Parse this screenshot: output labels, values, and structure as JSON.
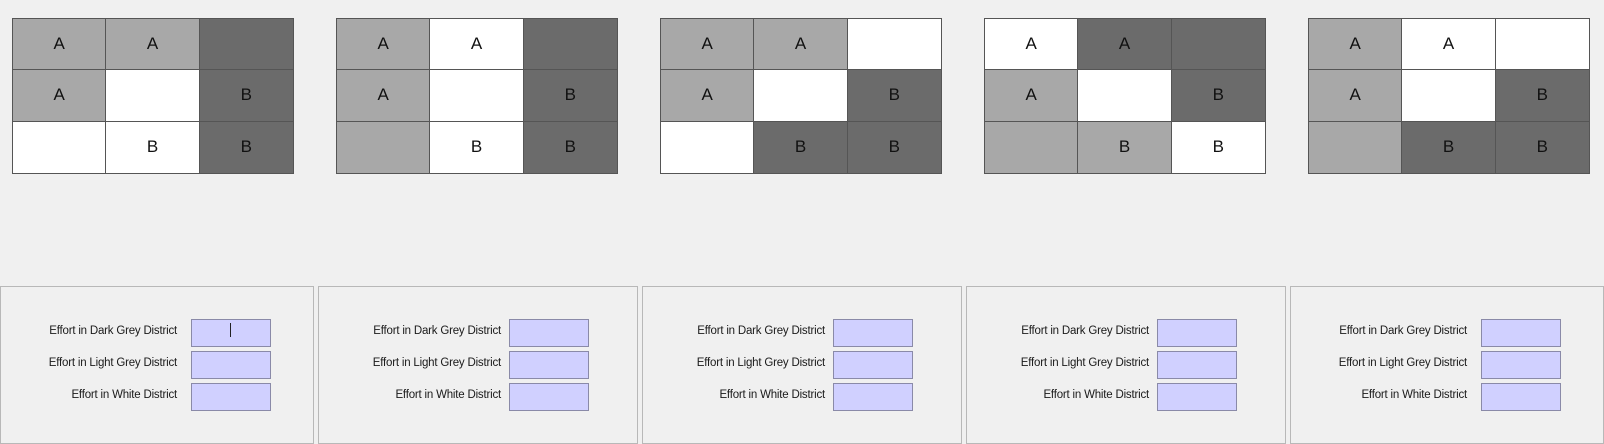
{
  "colors": {
    "dark": "#6b6b6b",
    "light": "#a8a8a8",
    "white": "#ffffff",
    "input": "#d0d0ff",
    "background": "#f0f0f0"
  },
  "grids": [
    {
      "cells": [
        {
          "shade": "light",
          "label": "A"
        },
        {
          "shade": "light",
          "label": "A"
        },
        {
          "shade": "dark",
          "label": ""
        },
        {
          "shade": "light",
          "label": "A"
        },
        {
          "shade": "white",
          "label": ""
        },
        {
          "shade": "dark",
          "label": "B"
        },
        {
          "shade": "white",
          "label": ""
        },
        {
          "shade": "white",
          "label": "B"
        },
        {
          "shade": "dark",
          "label": "B"
        }
      ]
    },
    {
      "cells": [
        {
          "shade": "light",
          "label": "A"
        },
        {
          "shade": "white",
          "label": "A"
        },
        {
          "shade": "dark",
          "label": ""
        },
        {
          "shade": "light",
          "label": "A"
        },
        {
          "shade": "white",
          "label": ""
        },
        {
          "shade": "dark",
          "label": "B"
        },
        {
          "shade": "light",
          "label": ""
        },
        {
          "shade": "white",
          "label": "B"
        },
        {
          "shade": "dark",
          "label": "B"
        }
      ]
    },
    {
      "cells": [
        {
          "shade": "light",
          "label": "A"
        },
        {
          "shade": "light",
          "label": "A"
        },
        {
          "shade": "white",
          "label": ""
        },
        {
          "shade": "light",
          "label": "A"
        },
        {
          "shade": "white",
          "label": ""
        },
        {
          "shade": "dark",
          "label": "B"
        },
        {
          "shade": "white",
          "label": ""
        },
        {
          "shade": "dark",
          "label": "B"
        },
        {
          "shade": "dark",
          "label": "B"
        }
      ]
    },
    {
      "cells": [
        {
          "shade": "white",
          "label": "A"
        },
        {
          "shade": "dark",
          "label": "A"
        },
        {
          "shade": "dark",
          "label": ""
        },
        {
          "shade": "light",
          "label": "A"
        },
        {
          "shade": "white",
          "label": ""
        },
        {
          "shade": "dark",
          "label": "B"
        },
        {
          "shade": "light",
          "label": ""
        },
        {
          "shade": "light",
          "label": "B"
        },
        {
          "shade": "white",
          "label": "B"
        }
      ]
    },
    {
      "cells": [
        {
          "shade": "light",
          "label": "A"
        },
        {
          "shade": "white",
          "label": "A"
        },
        {
          "shade": "white",
          "label": ""
        },
        {
          "shade": "light",
          "label": "A"
        },
        {
          "shade": "white",
          "label": ""
        },
        {
          "shade": "dark",
          "label": "B"
        },
        {
          "shade": "light",
          "label": ""
        },
        {
          "shade": "dark",
          "label": "B"
        },
        {
          "shade": "dark",
          "label": "B"
        }
      ]
    }
  ],
  "panels": [
    {
      "fields": [
        {
          "label": "Effort in Dark Grey District",
          "value": ""
        },
        {
          "label": "Effort in Light Grey District",
          "value": ""
        },
        {
          "label": "Effort in White District",
          "value": ""
        }
      ]
    },
    {
      "fields": [
        {
          "label": "Effort in Dark Grey District",
          "value": ""
        },
        {
          "label": "Effort in Light Grey District",
          "value": ""
        },
        {
          "label": "Effort in White District",
          "value": ""
        }
      ]
    },
    {
      "fields": [
        {
          "label": "Effort in Dark Grey District",
          "value": ""
        },
        {
          "label": "Effort in Light Grey District",
          "value": ""
        },
        {
          "label": "Effort in White District",
          "value": ""
        }
      ]
    },
    {
      "fields": [
        {
          "label": "Effort in Dark Grey District",
          "value": ""
        },
        {
          "label": "Effort in Light Grey District",
          "value": ""
        },
        {
          "label": "Effort in White District",
          "value": ""
        }
      ]
    },
    {
      "fields": [
        {
          "label": "Effort in Dark Grey District",
          "value": ""
        },
        {
          "label": "Effort in Light Grey District",
          "value": ""
        },
        {
          "label": "Effort in White District",
          "value": ""
        }
      ]
    }
  ]
}
